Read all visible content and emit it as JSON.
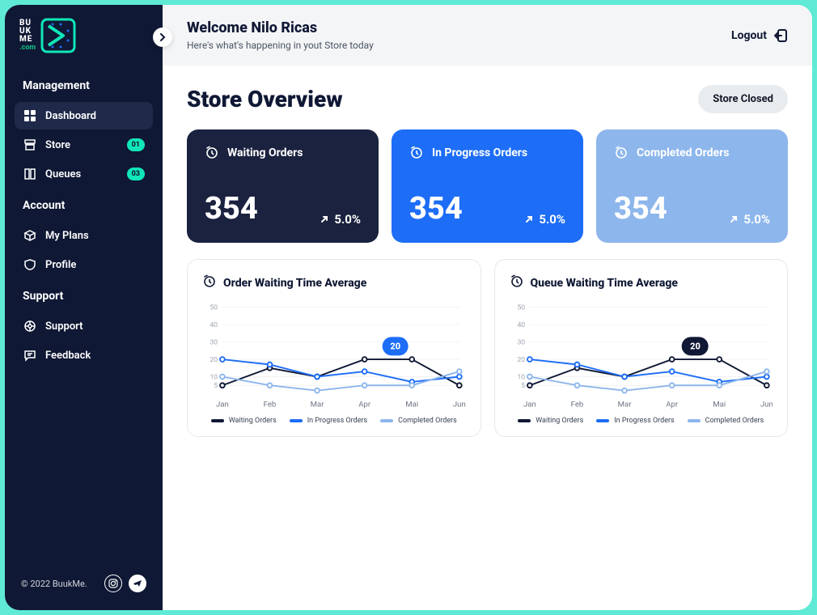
{
  "brand": {
    "t1": "BU",
    "t2": "UK",
    "t3": "ME",
    "com": ".com"
  },
  "sidebar": {
    "sections": [
      {
        "title": "Management",
        "items": [
          {
            "label": "Dashboard",
            "active": true
          },
          {
            "label": "Store",
            "badge": "01"
          },
          {
            "label": "Queues",
            "badge": "03"
          }
        ]
      },
      {
        "title": "Account",
        "items": [
          {
            "label": "My Plans"
          },
          {
            "label": "Profile"
          }
        ]
      },
      {
        "title": "Support",
        "items": [
          {
            "label": "Support"
          },
          {
            "label": "Feedback"
          }
        ]
      }
    ],
    "footer": "© 2022 BuukMe."
  },
  "topbar": {
    "welcome": "Welcome Nilo Ricas",
    "subtitle": "Here's what's happening in yout Store today",
    "logout": "Logout"
  },
  "page": {
    "title": "Store Overview",
    "store_status": "Store Closed"
  },
  "cards": [
    {
      "title": "Waiting Orders",
      "value": "354",
      "change": "5.0%"
    },
    {
      "title": "In Progress Orders",
      "value": "354",
      "change": "5.0%"
    },
    {
      "title": "Completed Orders",
      "value": "354",
      "change": "5.0%"
    }
  ],
  "charts": [
    {
      "title": "Order Waiting Time Average",
      "tooltip": "20",
      "tooltip_style": "blue",
      "tooltip_x": 3.65,
      "tooltip_y": 20
    },
    {
      "title": "Queue Waiting Time Average",
      "tooltip": "20",
      "tooltip_style": "dark",
      "tooltip_x": 3.5,
      "tooltip_y": 20
    }
  ],
  "chart_data": [
    {
      "type": "line",
      "title": "Order Waiting Time Average",
      "categories": [
        "Jan",
        "Feb",
        "Mar",
        "Apr",
        "Mai",
        "Jun"
      ],
      "ylabel": "",
      "xlabel": "",
      "ylim": [
        0,
        50
      ],
      "yticks": [
        5,
        10,
        20,
        30,
        40,
        50
      ],
      "series": [
        {
          "name": "Waiting Orders",
          "color": "#0f1834",
          "values": [
            5,
            15,
            10,
            20,
            20,
            5
          ]
        },
        {
          "name": "In Progress Orders",
          "color": "#1d6df6",
          "values": [
            20,
            17,
            10,
            13,
            7,
            10
          ]
        },
        {
          "name": "Completed Orders",
          "color": "#8db6ec",
          "values": [
            10,
            5,
            2,
            5,
            5,
            13
          ]
        }
      ],
      "legend": [
        "Waiting Orders",
        "In Progress Orders",
        "Completed Orders"
      ]
    },
    {
      "type": "line",
      "title": "Queue Waiting Time Average",
      "categories": [
        "Jan",
        "Feb",
        "Mar",
        "Apr",
        "Mai",
        "Jun"
      ],
      "ylabel": "",
      "xlabel": "",
      "ylim": [
        0,
        50
      ],
      "yticks": [
        5,
        10,
        20,
        30,
        40,
        50
      ],
      "series": [
        {
          "name": "Waiting Orders",
          "color": "#0f1834",
          "values": [
            5,
            15,
            10,
            20,
            20,
            5
          ]
        },
        {
          "name": "In Progress Orders",
          "color": "#1d6df6",
          "values": [
            20,
            17,
            10,
            13,
            7,
            10
          ]
        },
        {
          "name": "Completed Orders",
          "color": "#8db6ec",
          "values": [
            10,
            5,
            2,
            5,
            5,
            13
          ]
        }
      ],
      "legend": [
        "Waiting Orders",
        "In Progress Orders",
        "Completed Orders"
      ]
    }
  ]
}
